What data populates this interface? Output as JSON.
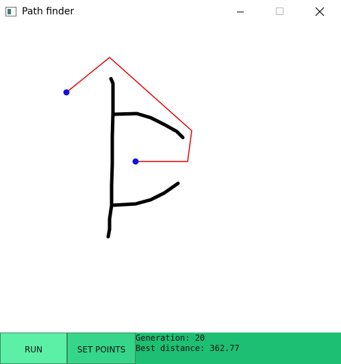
{
  "window": {
    "title": "Path finder",
    "icon": "app-window-icon"
  },
  "window_controls": {
    "minimize_icon": "minimize-icon",
    "maximize_icon": "maximize-icon",
    "close_icon": "close-icon"
  },
  "colors": {
    "background": "#ffffff",
    "path": "#e00000",
    "point": "#1010e0",
    "obstacle": "#000000",
    "bottom_bar": "#1dbf73",
    "run_button": "#5cf0a6",
    "set_points_button": "#36d68a"
  },
  "toolbar": {
    "run_label": "RUN",
    "set_points_label": "SET POINTS"
  },
  "status": {
    "generation_text": "Generation: 20",
    "best_distance_text": "Best distance: 362.77"
  }
}
